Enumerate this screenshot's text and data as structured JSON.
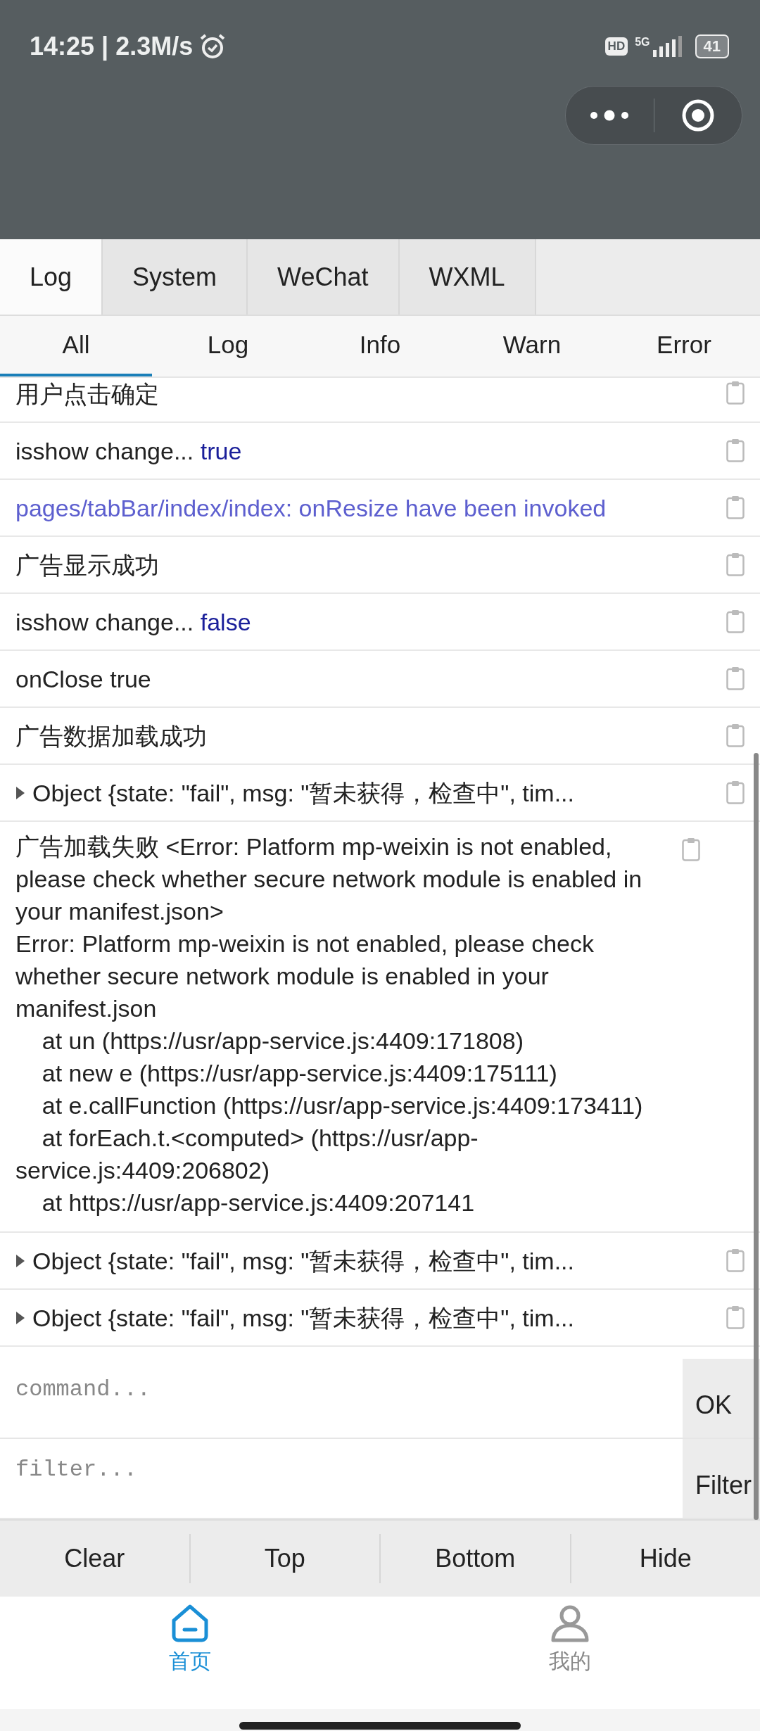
{
  "status_bar": {
    "time": "14:25 | 2.3M/s",
    "hd": "HD",
    "network": "5G",
    "battery": "41"
  },
  "tabs": [
    {
      "label": "Log",
      "selected": true
    },
    {
      "label": "System",
      "selected": false
    },
    {
      "label": "WeChat",
      "selected": false
    },
    {
      "label": "WXML",
      "selected": false
    }
  ],
  "filters": [
    {
      "label": "All",
      "selected": true
    },
    {
      "label": "Log",
      "selected": false
    },
    {
      "label": "Info",
      "selected": false
    },
    {
      "label": "Warn",
      "selected": false
    },
    {
      "label": "Error",
      "selected": false
    }
  ],
  "logs": [
    {
      "kind": "plain",
      "text": "用户点击确定"
    },
    {
      "kind": "value",
      "text": "isshow change...",
      "value": "true"
    },
    {
      "kind": "system",
      "text": "pages/tabBar/index/index: onResize have been invoked"
    },
    {
      "kind": "plain",
      "text": "广告显示成功"
    },
    {
      "kind": "value",
      "text": "isshow change...",
      "value": "false"
    },
    {
      "kind": "plain",
      "text": "onClose true"
    },
    {
      "kind": "plain",
      "text": "广告数据加载成功"
    },
    {
      "kind": "object",
      "text": "Object {state: \"fail\", msg: \"暂未获得，检查中\", tim..."
    },
    {
      "kind": "multiline",
      "lines": [
        "广告加载失败 <Error: Platform mp-weixin is not enabled, please check whether secure network module is enabled in your manifest.json>",
        "Error: Platform mp-weixin is not enabled, please check whether secure network module is enabled in your manifest.json",
        "    at un (https://usr/app-service.js:4409:171808)",
        "    at new e (https://usr/app-service.js:4409:175111)",
        "    at e.callFunction (https://usr/app-service.js:4409:173411)",
        "    at forEach.t.<computed> (https://usr/app-service.js:4409:206802)",
        "    at https://usr/app-service.js:4409:207141"
      ]
    },
    {
      "kind": "object",
      "text": "Object {state: \"fail\", msg: \"暂未获得，检查中\", tim..."
    },
    {
      "kind": "object",
      "text": "Object {state: \"fail\", msg: \"暂未获得，检查中\", tim..."
    }
  ],
  "command": {
    "placeholder": "command...",
    "button": "OK"
  },
  "filter": {
    "placeholder": "filter...",
    "button": "Filter"
  },
  "toolbar": [
    "Clear",
    "Top",
    "Bottom",
    "Hide"
  ],
  "tab_bar": [
    {
      "label": "首页",
      "kind": "home",
      "selected": true
    },
    {
      "label": "我的",
      "kind": "profile",
      "selected": false
    }
  ]
}
